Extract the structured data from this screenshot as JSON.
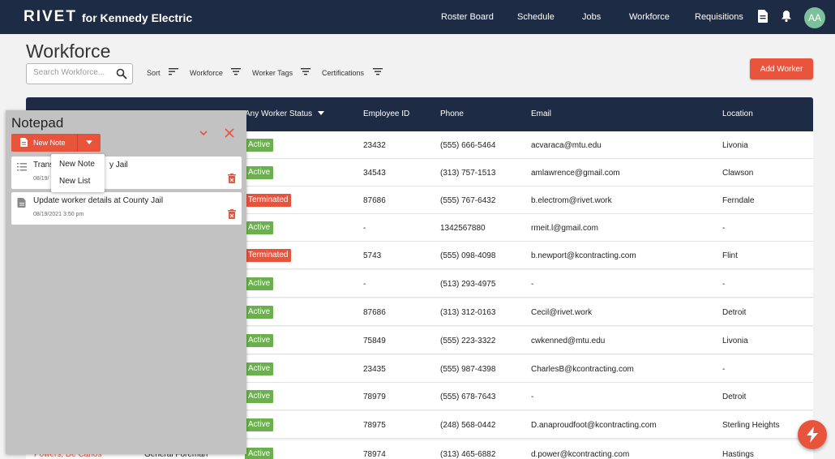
{
  "nav": {
    "brand": "RIVET",
    "brand_sub": "for Kennedy Electric",
    "links": [
      "Roster Board",
      "Schedule",
      "Jobs",
      "Workforce",
      "Requisitions"
    ],
    "avatar_initials": "AA"
  },
  "page": {
    "title": "Workforce",
    "search_placeholder": "Search Workforce...",
    "filters": [
      "Sort",
      "Workforce",
      "Worker Tags",
      "Certifications"
    ],
    "add_button": "Add Worker"
  },
  "table": {
    "headers": [
      "Any Worker Status",
      "Employee ID",
      "Phone",
      "Email",
      "Location"
    ],
    "rows": [
      {
        "name": "",
        "role": "",
        "status": "Active",
        "status_type": "active",
        "id": "23432",
        "phone": "(555) 666-5464",
        "email": "acvaraca@mtu.edu",
        "location": "Livonia"
      },
      {
        "name": "",
        "role": "",
        "status": "Active",
        "status_type": "active",
        "id": "34543",
        "phone": "(313) 757-1513",
        "email": "amlawrence@gmail.com",
        "location": "Clawson"
      },
      {
        "name": "",
        "role": "",
        "status": "Terminated",
        "status_type": "terminated",
        "id": "87686",
        "phone": "(555) 767-6432",
        "email": "b.electrom@rivet.work",
        "location": "Ferndale"
      },
      {
        "name": "",
        "role": "",
        "status": "Active",
        "status_type": "active",
        "id": "-",
        "phone": "1342567880",
        "email": "rmeit.l@gmail.com",
        "location": "-"
      },
      {
        "name": "",
        "role": "",
        "status": "Terminated",
        "status_type": "terminated",
        "id": "5743",
        "phone": "(555) 098-4098",
        "email": "b.newport@kcontracting.com",
        "location": "Flint"
      },
      {
        "name": "",
        "role": "",
        "status": "Active",
        "status_type": "active",
        "id": "-",
        "phone": "(513) 293-4975",
        "email": "-",
        "location": "-"
      },
      {
        "name": "",
        "role": "",
        "status": "Active",
        "status_type": "active",
        "id": "87686",
        "phone": "(313) 312-0163",
        "email": "Cecil@rivet.work",
        "location": "Detroit"
      },
      {
        "name": "",
        "role": "",
        "status": "Active",
        "status_type": "active",
        "id": "75849",
        "phone": "(555) 223-3322",
        "email": "cwkenned@mtu.edu",
        "location": "Livonia"
      },
      {
        "name": "",
        "role": "",
        "status": "Active",
        "status_type": "active",
        "id": "23435",
        "phone": "(555) 987-4398",
        "email": "CharlesB@kcontracting.com",
        "location": "-"
      },
      {
        "name": "",
        "role": "",
        "status": "Active",
        "status_type": "active",
        "id": "78979",
        "phone": "(555) 678-7643",
        "email": "-",
        "location": "Detroit"
      },
      {
        "name": "",
        "role": "",
        "status": "Active",
        "status_type": "active",
        "id": "78975",
        "phone": "(248) 568-0442",
        "email": "D.anaproudfoot@kcontracting.com",
        "location": "Sterling Heights"
      },
      {
        "name": "Powers, De Carlos",
        "role": "General Foreman",
        "status": "Active",
        "status_type": "active",
        "id": "78974",
        "phone": "(313) 465-6882",
        "email": "d.power@kcontracting.com",
        "location": "Hastings"
      }
    ]
  },
  "notepad": {
    "title": "Notepad",
    "new_note_button": "New Note",
    "notes": [
      {
        "title_left": "Trans",
        "title_right": "y Jail",
        "date": "08/19/",
        "icon": "list-icon"
      },
      {
        "title": "Update worker details at County Jail",
        "date": "08/19/2021 3:50 pm",
        "icon": "document-icon"
      }
    ],
    "menu": [
      "New Note",
      "New List"
    ]
  },
  "colors": {
    "navy": "#1d2b45",
    "accent": "#e8533c",
    "active": "#6ab04c"
  }
}
